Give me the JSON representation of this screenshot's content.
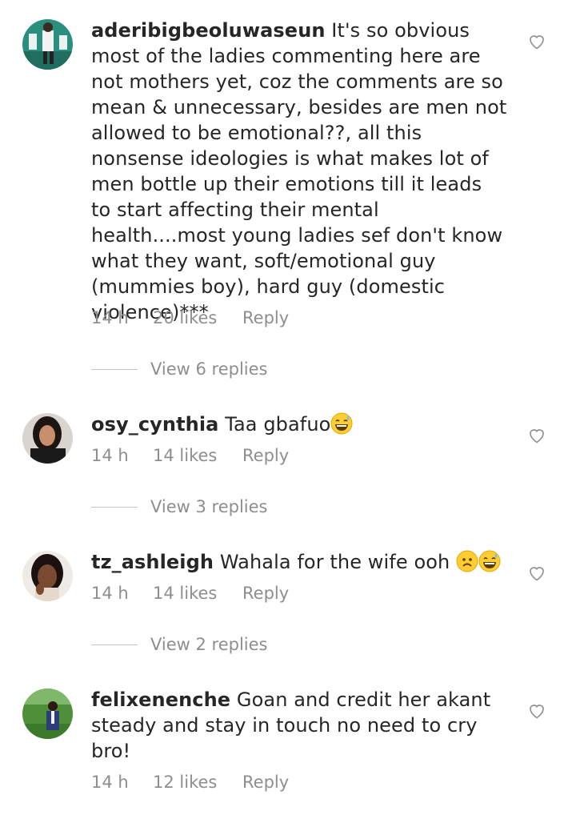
{
  "comments": [
    {
      "username": "aderibigbeoluwaseun",
      "text": "It's so obvious most of the ladies commenting here are not mothers yet, coz the comments are so mean & unnecessary, besides are men not allowed to be emotional??, all this nonsense ideologies is what makes lot of men bottle up their emotions till it leads to start affecting their mental health....most young ladies sef don't know what they want, soft/emotional guy (mummies boy), hard guy (domestic violence)***",
      "time": "14 h",
      "likes": "20 likes",
      "reply": "Reply",
      "view_replies": "View 6 replies"
    },
    {
      "username": "osy_cynthia",
      "text": "Taa gbafuo",
      "emojis": [
        "grinning-sweat-emoji"
      ],
      "time": "14 h",
      "likes": "14 likes",
      "reply": "Reply",
      "view_replies": "View 3 replies"
    },
    {
      "username": "tz_ashleigh",
      "text": "Wahala for the wife ooh",
      "emojis": [
        "worried-face-emoji",
        "grinning-sweat-emoji"
      ],
      "time": "14 h",
      "likes": "14 likes",
      "reply": "Reply",
      "view_replies": "View 2 replies"
    },
    {
      "username": "felixenenche",
      "text": "Goan and credit her akant steady and stay in touch no need to cry bro!",
      "time": "14 h",
      "likes": "12 likes",
      "reply": "Reply"
    }
  ],
  "icons": {
    "like": "heart-outline-icon"
  },
  "colors": {
    "text": "#262626",
    "muted": "#8e8e8e",
    "divider": "#c7c7c7"
  }
}
